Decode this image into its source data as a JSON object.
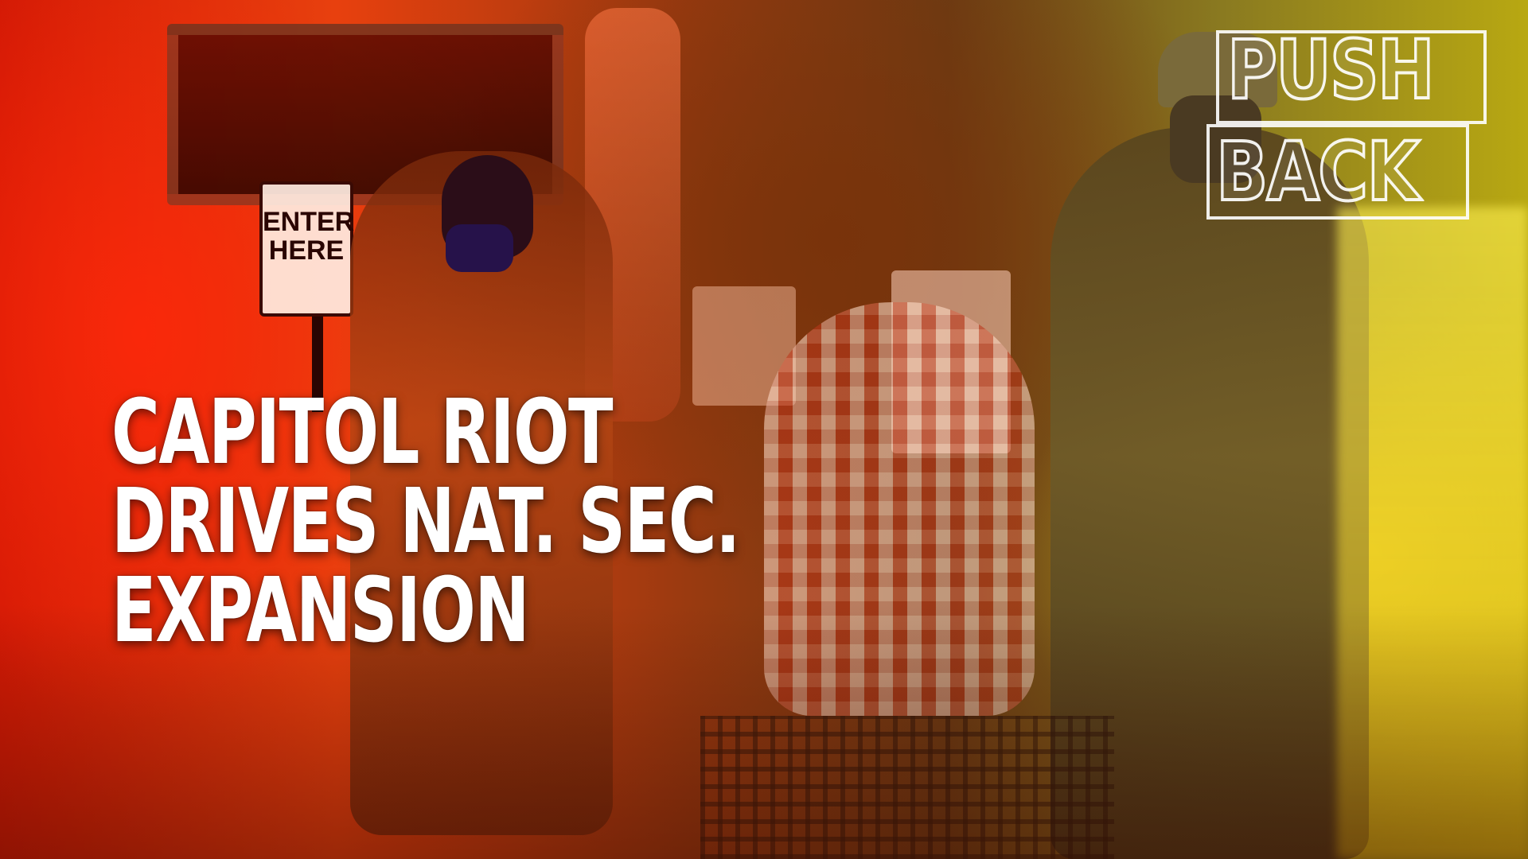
{
  "sign": {
    "text_line1": "ENTER",
    "text_line2": "HERE"
  },
  "headline": {
    "line1": "CAPITOL RIOT",
    "line2": "DRIVES NAT. SEC.",
    "line3": "EXPANSION"
  },
  "logo": {
    "line1": "PUSH",
    "line2": "BACK"
  },
  "colors": {
    "headline_text": "#ffffff",
    "left_tint": "#d41a05",
    "right_tint": "#b8a812"
  }
}
